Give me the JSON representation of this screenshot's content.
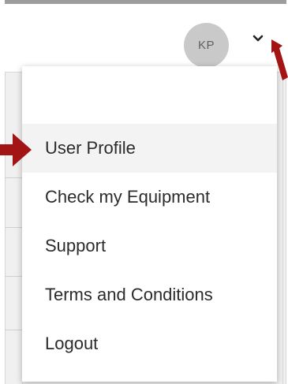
{
  "user": {
    "initials": "KP"
  },
  "header": {
    "chevron_icon": "chevron-down-icon"
  },
  "menu": {
    "items": [
      {
        "label": "User Profile",
        "active": true
      },
      {
        "label": "Check my Equipment",
        "active": false
      },
      {
        "label": "Support",
        "active": false
      },
      {
        "label": "Terms and Conditions",
        "active": false
      },
      {
        "label": "Logout",
        "active": false
      }
    ]
  },
  "colors": {
    "annotation_arrow": "#a31515",
    "avatar_bg": "#c9c9c9",
    "active_item_bg": "#f3f3f3"
  }
}
